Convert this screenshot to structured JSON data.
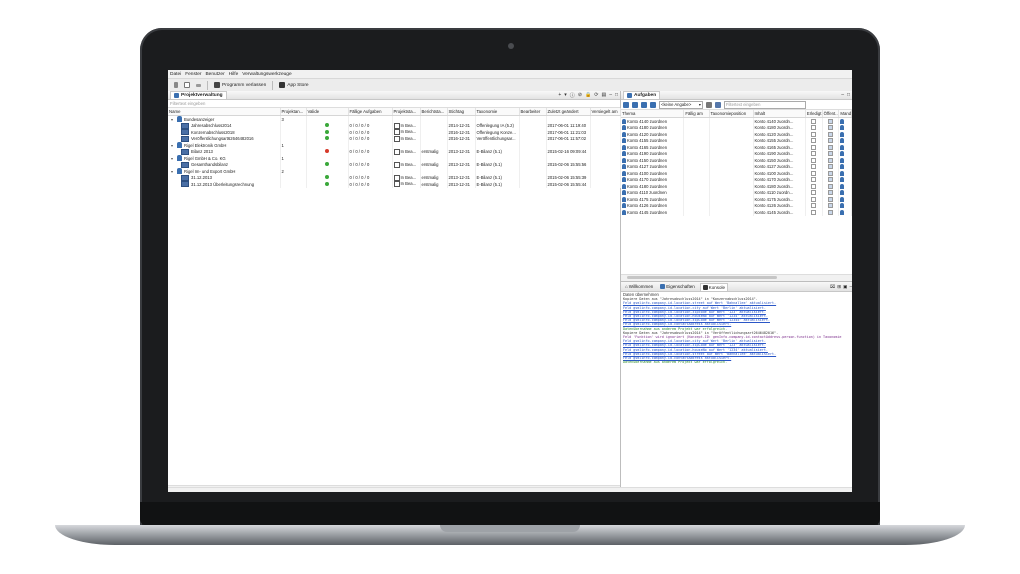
{
  "menu": [
    "Datei",
    "Fenster",
    "Benutzer",
    "Hilfe",
    "Verwaltungswerkzeuge"
  ],
  "toolbar": {
    "leave_label": "Programm verlassen",
    "appstore_label": "App Store"
  },
  "projects": {
    "tab_title": "Projektverwaltung",
    "filter_placeholder": "Filtertext eingeben",
    "columns": [
      "Name",
      "Projektan...",
      "Valide",
      "Fällige Aufgaben",
      "Projektsta...",
      "Berichtsta...",
      "Stichtag",
      "Taxonomie",
      "Bearbeiter",
      "Zuletzt geändert",
      "Versiegelt am"
    ],
    "rows": [
      {
        "level": 0,
        "type": "group",
        "name": "Bundesanzeiger",
        "count": "3",
        "valid": "",
        "tasks": "",
        "status": "",
        "report": "",
        "date": "",
        "tax": "",
        "editor": "",
        "changed": ""
      },
      {
        "level": 1,
        "type": "doc",
        "name": "Jahresabschluss2014",
        "count": "",
        "valid": "green",
        "tasks": "0 / 0 / 0 / 0",
        "status": "In Bea...",
        "report": "",
        "date": "2014-12-31",
        "tax": "Offenlegung IA (5.2)",
        "editor": "",
        "changed": "2017-06-01 11:19:40"
      },
      {
        "level": 1,
        "type": "doc",
        "name": "Konzernabschluss2018",
        "count": "",
        "valid": "green",
        "tasks": "0 / 0 / 0 / 0",
        "status": "In Bea...",
        "report": "",
        "date": "2016-12-31",
        "tax": "Offenlegung Konze...",
        "editor": "",
        "changed": "2017-06-01 11:21:03"
      },
      {
        "level": 1,
        "type": "doc",
        "name": "Veröffentlichungsart62646482016",
        "count": "",
        "valid": "green",
        "tasks": "0 / 0 / 0 / 0",
        "status": "In Bea...",
        "report": "",
        "date": "2016-12-31",
        "tax": "Veröffentlichungsar...",
        "editor": "",
        "changed": "2017-06-01 11:57:02"
      },
      {
        "level": 0,
        "type": "group",
        "name": "Rigel Elektronik GmbH",
        "count": "1",
        "valid": "",
        "tasks": "",
        "status": "",
        "report": "",
        "date": "",
        "tax": "",
        "editor": "",
        "changed": ""
      },
      {
        "level": 1,
        "type": "doc",
        "name": "Bilanz 2013",
        "count": "",
        "valid": "red",
        "tasks": "0 / 0 / 0 / 0",
        "status": "In Bea...",
        "report": "erstmalig",
        "date": "2013-12-31",
        "tax": "E-Bilanz (5.1)",
        "editor": "",
        "changed": "2015-02-16 09:09:44"
      },
      {
        "level": 0,
        "type": "group",
        "name": "Rigel GmbH & Co. KG",
        "count": "1",
        "valid": "",
        "tasks": "",
        "status": "",
        "report": "",
        "date": "",
        "tax": "",
        "editor": "",
        "changed": ""
      },
      {
        "level": 1,
        "type": "doc",
        "name": "Gesamthandsbilanz",
        "count": "",
        "valid": "green",
        "tasks": "0 / 0 / 0 / 0",
        "status": "In Bea...",
        "report": "erstmalig",
        "date": "2013-12-31",
        "tax": "E-Bilanz (5.1)",
        "editor": "",
        "changed": "2015-02-06 15:55:56"
      },
      {
        "level": 0,
        "type": "group",
        "name": "Rigel Im- und Export GmbH",
        "count": "2",
        "valid": "",
        "tasks": "",
        "status": "",
        "report": "",
        "date": "",
        "tax": "",
        "editor": "",
        "changed": ""
      },
      {
        "level": 1,
        "type": "doc",
        "name": "31.12.2013",
        "count": "",
        "valid": "green",
        "tasks": "0 / 0 / 0 / 0",
        "status": "In Bea...",
        "report": "erstmalig",
        "date": "2013-12-31",
        "tax": "E-Bilanz (5.1)",
        "editor": "",
        "changed": "2015-02-06 15:55:39"
      },
      {
        "level": 1,
        "type": "doc",
        "name": "31.12.2013 Überleitungsrechnung",
        "count": "",
        "valid": "green",
        "tasks": "0 / 0 / 0 / 0",
        "status": "In Bea...",
        "report": "erstmalig",
        "date": "2013-12-31",
        "tax": "E-Bilanz (5.1)",
        "editor": "",
        "changed": "2015-02-06 15:55:44"
      }
    ]
  },
  "tasks": {
    "tab_title": "Aufgaben",
    "select_value": "<keine Angabe>",
    "filter_placeholder": "Filtertext eingeben",
    "columns": [
      "Thema",
      "Fällig am",
      "Taxonomieposition",
      "Inhalt",
      "Erledigt",
      "Öffent...",
      "Mand"
    ],
    "rows": [
      {
        "thema": "Konto 4140 zuordnen",
        "inhalt": "Konto 4140 zuordn..."
      },
      {
        "thema": "Konto 4180 zuordnen",
        "inhalt": "Konto 4180 zuordn..."
      },
      {
        "thema": "Konto 4120 zuordnen",
        "inhalt": "Konto 4120 zuordn..."
      },
      {
        "thema": "Konto 4155 zuordnen",
        "inhalt": "Konto 4155 zuordn..."
      },
      {
        "thema": "Konto 4165 zuordnen",
        "inhalt": "Konto 4165 zuordn..."
      },
      {
        "thema": "Konto 4190 zuordnen",
        "inhalt": "Konto 4190 zuordn..."
      },
      {
        "thema": "Konto 4150 zuordnen",
        "inhalt": "Konto 4150 zuordn..."
      },
      {
        "thema": "Konto 4127 zuordnen",
        "inhalt": "Konto 4127 zuordn..."
      },
      {
        "thema": "Konto 4100 zuordnen",
        "inhalt": "Konto 4100 zuordn..."
      },
      {
        "thema": "Konto 4170 zuordnen",
        "inhalt": "Konto 4170 zuordn..."
      },
      {
        "thema": "Konto 4180 zuordnen",
        "inhalt": "Konto 4180 zuordn..."
      },
      {
        "thema": "Konto 4110 zuordnen",
        "inhalt": "Konto 4110 zuordn..."
      },
      {
        "thema": "Konto 4175 zuordnen",
        "inhalt": "Konto 4175 zuordn..."
      },
      {
        "thema": "Konto 4126 zuordnen",
        "inhalt": "Konto 4126 zuordn..."
      },
      {
        "thema": "Konto 4145 zuordnen",
        "inhalt": "Konto 4145 zuordn..."
      }
    ]
  },
  "console": {
    "tabs": [
      "Willkommen",
      "Eigenschaften",
      "Konsole"
    ],
    "header": "Daten übernehmen",
    "lines": [
      {
        "text": "Kopiere Daten aus \"Jahresabschluss2014\" in \"Konzernabschluss2014\".",
        "cls": ""
      },
      {
        "text": "  Feld  gsmlinfo.company.id.location.street  auf Wert 'Bahnallee' aktualisiert.",
        "cls": "link"
      },
      {
        "text": "  Feld  gsmlinfo.company.id.location.city  auf Wert 'Berlin' aktualisiert.",
        "cls": "link"
      },
      {
        "text": "  Feld  gsmlinfo.company.id.location.zipcode  auf Wert '123' aktualisiert.",
        "cls": "link"
      },
      {
        "text": "  Feld  gsmlinfo.company.id.location.houseNo  auf Wert '1234' aktualisiert.",
        "cls": "link"
      },
      {
        "text": "  Feld  gsmlinfo.company.id.location.zipCode  auf Wert '12345' aktualisiert.",
        "cls": "link"
      },
      {
        "text": "  Feld  gsmlinfo.company.id.contactAddress  aktualisiert.",
        "cls": "link"
      },
      {
        "text": "Datenübernahme aus anderem Projekt war erfolgreich.",
        "cls": "green"
      },
      {
        "text": "Kopiere Daten aus \"Jahresabschluss2014\" in \"Veröffentlichungsart2646482016\".",
        "cls": ""
      },
      {
        "text": "  Feld 'Funktion' wird ignoriert (Konzept-ID: genInfo.company.id.contactAddress.person.function) in Taxonomie",
        "cls": "purple"
      },
      {
        "text": "  Feld  gsmlinfo.company.id.location.city  auf Wert 'Berlin' aktualisiert.",
        "cls": "link"
      },
      {
        "text": "  Feld  gsmlinfo.company.id.location.zipCode  auf Wert '123' aktualisiert.",
        "cls": "link"
      },
      {
        "text": "  Feld  gsmlinfo.company.id.location.houseNo  auf Wert '1234' aktualisiert.",
        "cls": "link"
      },
      {
        "text": "  Feld  gsmlinfo.company.id.location.street  auf Wert 'Bahnallee' aktualisiert.",
        "cls": "link"
      },
      {
        "text": "  Feld  gsmlinfo.company.id.contactAddress  aktualisiert.",
        "cls": "link"
      },
      {
        "text": "Datenübernahme aus anderem Projekt war erfolgreich.",
        "cls": "green"
      }
    ]
  },
  "colors": {
    "accent": "#3a6fb0",
    "valid_green": "#3aa83a",
    "invalid_red": "#d63a2a"
  }
}
